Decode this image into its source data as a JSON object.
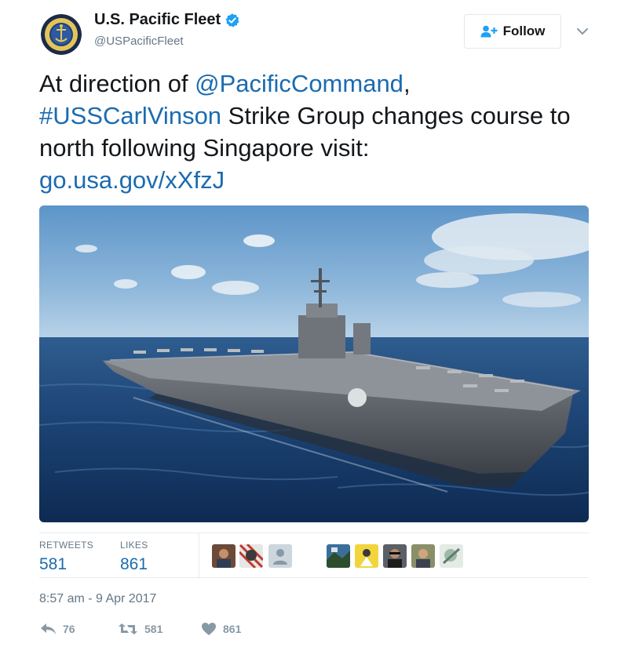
{
  "account": {
    "display_name": "U.S. Pacific Fleet",
    "handle": "@USPacificFleet",
    "avatar_icon": "navy-seal-icon",
    "verified_icon": "verified-badge-icon"
  },
  "follow_button": {
    "label": "Follow",
    "icon": "follow-person-icon"
  },
  "menu": {
    "icon": "chevron-down-icon"
  },
  "tweet": {
    "text_prefix": "At direction of ",
    "mention": "@PacificCommand",
    "text_comma": ",",
    "hashtag": "#USSCarlVinson",
    "text_body": " Strike Group changes course to north following Singapore visit:",
    "link": "go.usa.gov/xXfzJ"
  },
  "photo": {
    "subject": "aircraft-carrier-photo"
  },
  "stats": {
    "retweets_label": "RETWEETS",
    "retweets_value": "581",
    "likes_label": "LIKES",
    "likes_value": "861"
  },
  "likers": [
    "liker-1",
    "liker-2",
    "liker-3",
    "liker-4",
    "liker-5",
    "liker-6",
    "liker-7",
    "liker-8"
  ],
  "timestamp": "8:57 am - 9 Apr 2017",
  "actions": {
    "reply_count": "76",
    "retweet_count": "581",
    "like_count": "861"
  },
  "colors": {
    "link": "#1b6bb0",
    "verified": "#1da1f2",
    "text": "#14171a",
    "muted": "#657786"
  }
}
